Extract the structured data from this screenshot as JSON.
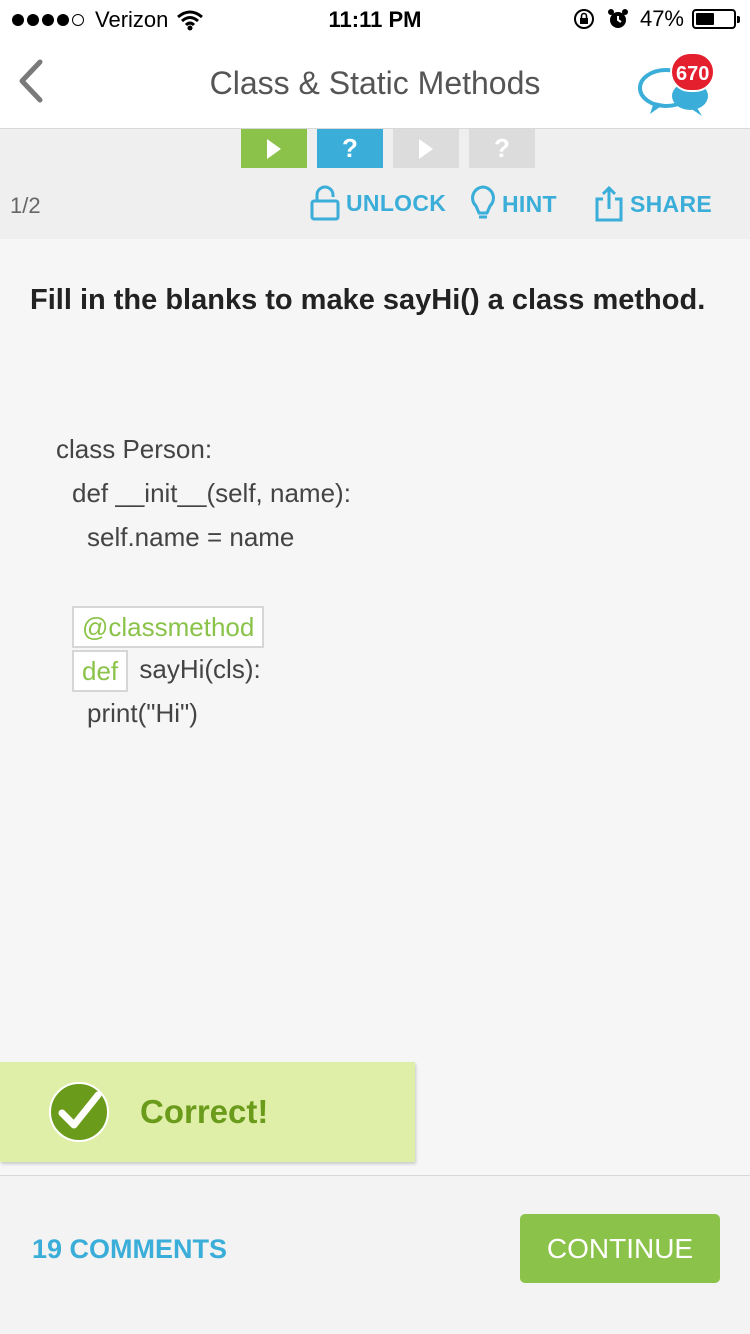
{
  "status_bar": {
    "carrier": "Verizon",
    "time": "11:11 PM",
    "battery": "47%",
    "icons": [
      "signal-dots",
      "wifi-icon",
      "rotation-lock-icon",
      "alarm-icon",
      "battery-icon"
    ]
  },
  "nav": {
    "title": "Class & Static Methods",
    "back_icon": "chevron-left-icon",
    "chat_icon": "chat-bubbles-icon",
    "chat_badge": "670"
  },
  "toolbar": {
    "steps": [
      {
        "type": "play",
        "state": "completed",
        "color": "#8bc34a"
      },
      {
        "type": "question",
        "state": "current",
        "color": "#3aaed8",
        "symbol": "?"
      },
      {
        "type": "play",
        "state": "locked",
        "color": "#dcdcdc"
      },
      {
        "type": "question",
        "state": "locked",
        "color": "#dcdcdc",
        "symbol": "?"
      }
    ],
    "counter": "1/2",
    "unlock_label": "UNLOCK",
    "hint_label": "HINT",
    "share_label": "SHARE"
  },
  "question": {
    "text": "Fill in the blanks to make sayHi() a class method."
  },
  "code": {
    "line1": "class Person:",
    "line2": "def __init__(self, name):",
    "line3": "self.name = name",
    "blank1": "@classmethod",
    "blank2": "def",
    "line5_rest": " sayHi(cls):",
    "line6": "print(\"Hi\")"
  },
  "feedback": {
    "text": "Correct!",
    "icon": "checkmark-icon"
  },
  "bottom": {
    "comments_label": "19 COMMENTS",
    "continue_label": "CONTINUE"
  },
  "colors": {
    "accent_blue": "#3aaed8",
    "accent_green": "#8bc34a",
    "badge_red": "#e5202e",
    "correct_bg": "#dfefa8"
  }
}
